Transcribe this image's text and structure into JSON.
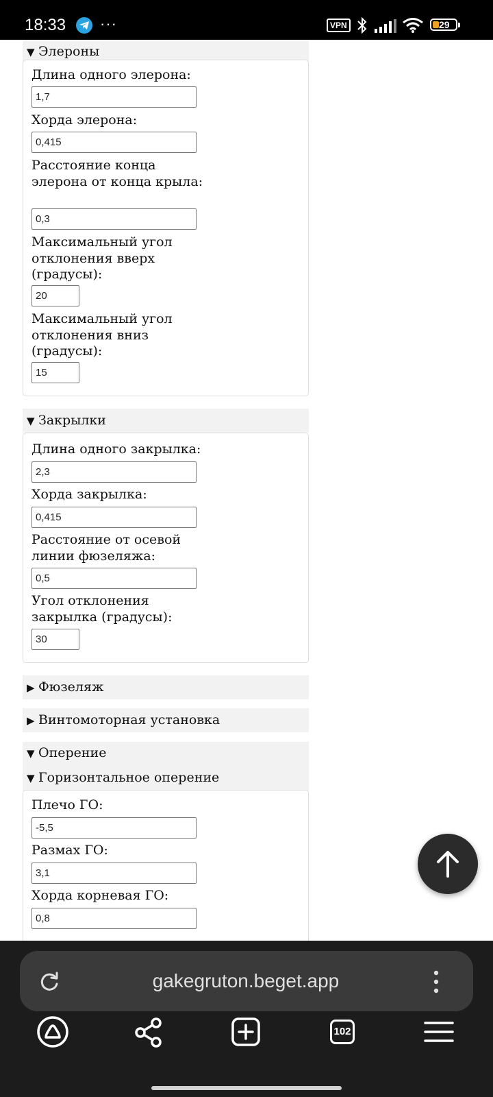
{
  "status_bar": {
    "time": "18:33",
    "more": "···",
    "vpn": "VPN",
    "battery": "29",
    "icons": [
      "telegram-icon",
      "bluetooth-icon",
      "signal-icon",
      "wifi-icon",
      "battery-icon"
    ]
  },
  "sections": {
    "ailerons": {
      "title": "Элероны",
      "fields": [
        {
          "label": "Длина одного элерона:",
          "value": "1,7"
        },
        {
          "label": "Хорда элерона:",
          "value": "0,415"
        },
        {
          "label": "Расстояние конца элерона от конца крыла:",
          "value": "0,3"
        },
        {
          "label": "Максимальный угол отклонения вверх (градусы):",
          "value": "20"
        },
        {
          "label": "Максимальный угол отклонения вниз (градусы):",
          "value": "15"
        }
      ]
    },
    "flaps": {
      "title": "Закрылки",
      "fields": [
        {
          "label": "Длина одного закрылка:",
          "value": "2,3"
        },
        {
          "label": "Хорда закрылка:",
          "value": "0,415"
        },
        {
          "label": "Расстояние от осевой линии фюзеляжа:",
          "value": "0,5"
        },
        {
          "label": "Угол отклонения закрылка (градусы):",
          "value": "30"
        }
      ]
    },
    "fuselage": {
      "title": "Фюзеляж"
    },
    "powerplant": {
      "title": "Винтомоторная установка"
    },
    "empennage": {
      "title": "Оперение",
      "horizontal": {
        "title": "Горизонтальное оперение",
        "fields": [
          {
            "label": "Плечо ГО:",
            "value": "-5,5"
          },
          {
            "label": "Размах ГО:",
            "value": "3,1"
          },
          {
            "label": "Хорда корневая ГО:",
            "value": "0,8"
          }
        ]
      }
    }
  },
  "triangles": {
    "open": "▼",
    "closed": "▶"
  },
  "browser": {
    "url": "gakegruton.beget.app",
    "tab_count": "102",
    "nav_icons": [
      "home-icon",
      "share-icon",
      "new-tab-icon",
      "tabs-icon",
      "menu-icon"
    ]
  }
}
